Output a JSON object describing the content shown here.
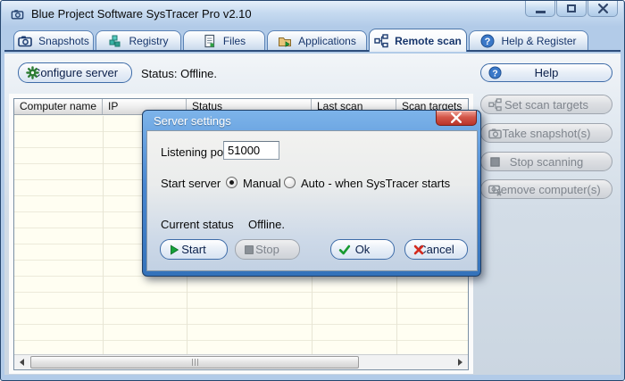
{
  "window": {
    "title": "Blue Project Software SysTracer Pro v2.10"
  },
  "tabs": [
    {
      "label": "Snapshots",
      "icon": "camera-icon",
      "active": false
    },
    {
      "label": "Registry",
      "icon": "registry-icon",
      "active": false
    },
    {
      "label": "Files",
      "icon": "file-icon",
      "active": false
    },
    {
      "label": "Applications",
      "icon": "applications-icon",
      "active": false
    },
    {
      "label": "Remote scan",
      "icon": "network-icon",
      "active": true
    },
    {
      "label": "Help & Register",
      "icon": "question-icon",
      "active": false
    }
  ],
  "toolbar": {
    "configure_server_label": "Configure server",
    "status": "Status: Offline."
  },
  "side_panel": {
    "help_label": "Help",
    "buttons": [
      {
        "label": "Set scan targets",
        "icon": "network-icon",
        "enabled": false
      },
      {
        "label": "Take snapshot(s)",
        "icon": "camera-icon",
        "enabled": false
      },
      {
        "label": "Stop scanning",
        "icon": "stop-square-icon",
        "enabled": false
      },
      {
        "label": "Remove computer(s)",
        "icon": "camera-remove-icon",
        "enabled": false
      }
    ]
  },
  "table": {
    "columns": [
      "Computer name",
      "IP",
      "Status",
      "Last scan",
      "Scan targets"
    ],
    "rows": []
  },
  "dialog": {
    "title": "Server settings",
    "listening_port_label": "Listening port",
    "listening_port_value": "51000",
    "start_server_label": "Start server",
    "radio_manual": "Manual",
    "radio_manual_selected": true,
    "radio_auto": "Auto - when SysTracer starts",
    "current_status_label": "Current status",
    "current_status_value": "Offline.",
    "buttons": {
      "start": "Start",
      "stop": "Stop",
      "ok": "Ok",
      "cancel": "Cancel"
    }
  },
  "colors": {
    "window_chrome": "#b2cbe8",
    "page_top": "#f2f5f8",
    "page_bottom": "#cbd6e1",
    "tab_text": "#16356b",
    "table_body": "#fffef2",
    "dialog_titlebar": "#4886d0",
    "dialog_close_red": "#b8342a",
    "accent_border_blue": "#3e6ca8",
    "gear_green": "#2e7d35",
    "ok_green": "#179a30",
    "cancel_red": "#d42a1e"
  }
}
